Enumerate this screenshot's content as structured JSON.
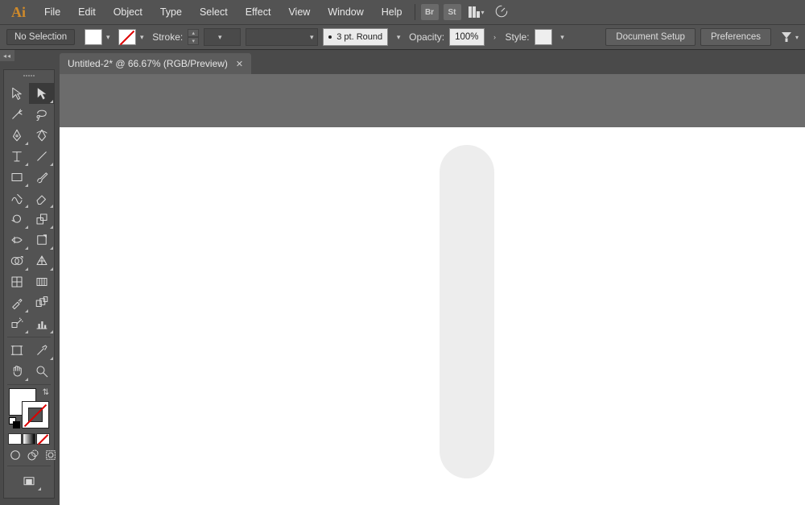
{
  "app": {
    "logo": "Ai"
  },
  "menu": {
    "items": [
      "File",
      "Edit",
      "Object",
      "Type",
      "Select",
      "Effect",
      "View",
      "Window",
      "Help"
    ],
    "bridge": "Br",
    "stock": "St"
  },
  "control": {
    "selection": "No Selection",
    "stroke_label": "Stroke:",
    "brush_profile": "3 pt. Round",
    "opacity_label": "Opacity:",
    "opacity_value": "100%",
    "style_label": "Style:",
    "doc_setup": "Document Setup",
    "preferences": "Preferences"
  },
  "tab": {
    "title": "Untitled-2* @ 66.67% (RGB/Preview)"
  }
}
